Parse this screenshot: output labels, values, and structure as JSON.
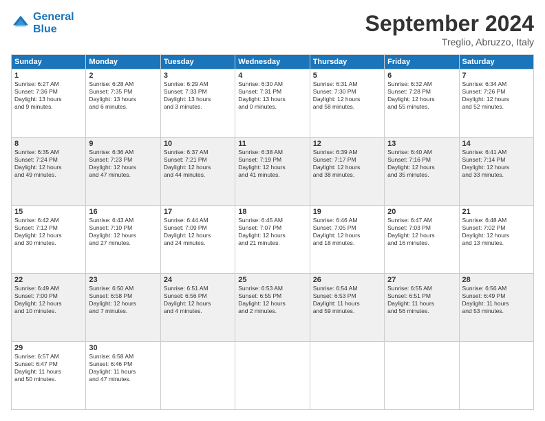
{
  "header": {
    "logo_line1": "General",
    "logo_line2": "Blue",
    "month": "September 2024",
    "location": "Treglio, Abruzzo, Italy"
  },
  "days_of_week": [
    "Sunday",
    "Monday",
    "Tuesday",
    "Wednesday",
    "Thursday",
    "Friday",
    "Saturday"
  ],
  "rows": [
    [
      {
        "day": "1",
        "lines": [
          "Sunrise: 6:27 AM",
          "Sunset: 7:36 PM",
          "Daylight: 13 hours",
          "and 9 minutes."
        ]
      },
      {
        "day": "2",
        "lines": [
          "Sunrise: 6:28 AM",
          "Sunset: 7:35 PM",
          "Daylight: 13 hours",
          "and 6 minutes."
        ]
      },
      {
        "day": "3",
        "lines": [
          "Sunrise: 6:29 AM",
          "Sunset: 7:33 PM",
          "Daylight: 13 hours",
          "and 3 minutes."
        ]
      },
      {
        "day": "4",
        "lines": [
          "Sunrise: 6:30 AM",
          "Sunset: 7:31 PM",
          "Daylight: 13 hours",
          "and 0 minutes."
        ]
      },
      {
        "day": "5",
        "lines": [
          "Sunrise: 6:31 AM",
          "Sunset: 7:30 PM",
          "Daylight: 12 hours",
          "and 58 minutes."
        ]
      },
      {
        "day": "6",
        "lines": [
          "Sunrise: 6:32 AM",
          "Sunset: 7:28 PM",
          "Daylight: 12 hours",
          "and 55 minutes."
        ]
      },
      {
        "day": "7",
        "lines": [
          "Sunrise: 6:34 AM",
          "Sunset: 7:26 PM",
          "Daylight: 12 hours",
          "and 52 minutes."
        ]
      }
    ],
    [
      {
        "day": "8",
        "lines": [
          "Sunrise: 6:35 AM",
          "Sunset: 7:24 PM",
          "Daylight: 12 hours",
          "and 49 minutes."
        ]
      },
      {
        "day": "9",
        "lines": [
          "Sunrise: 6:36 AM",
          "Sunset: 7:23 PM",
          "Daylight: 12 hours",
          "and 47 minutes."
        ]
      },
      {
        "day": "10",
        "lines": [
          "Sunrise: 6:37 AM",
          "Sunset: 7:21 PM",
          "Daylight: 12 hours",
          "and 44 minutes."
        ]
      },
      {
        "day": "11",
        "lines": [
          "Sunrise: 6:38 AM",
          "Sunset: 7:19 PM",
          "Daylight: 12 hours",
          "and 41 minutes."
        ]
      },
      {
        "day": "12",
        "lines": [
          "Sunrise: 6:39 AM",
          "Sunset: 7:17 PM",
          "Daylight: 12 hours",
          "and 38 minutes."
        ]
      },
      {
        "day": "13",
        "lines": [
          "Sunrise: 6:40 AM",
          "Sunset: 7:16 PM",
          "Daylight: 12 hours",
          "and 35 minutes."
        ]
      },
      {
        "day": "14",
        "lines": [
          "Sunrise: 6:41 AM",
          "Sunset: 7:14 PM",
          "Daylight: 12 hours",
          "and 33 minutes."
        ]
      }
    ],
    [
      {
        "day": "15",
        "lines": [
          "Sunrise: 6:42 AM",
          "Sunset: 7:12 PM",
          "Daylight: 12 hours",
          "and 30 minutes."
        ]
      },
      {
        "day": "16",
        "lines": [
          "Sunrise: 6:43 AM",
          "Sunset: 7:10 PM",
          "Daylight: 12 hours",
          "and 27 minutes."
        ]
      },
      {
        "day": "17",
        "lines": [
          "Sunrise: 6:44 AM",
          "Sunset: 7:09 PM",
          "Daylight: 12 hours",
          "and 24 minutes."
        ]
      },
      {
        "day": "18",
        "lines": [
          "Sunrise: 6:45 AM",
          "Sunset: 7:07 PM",
          "Daylight: 12 hours",
          "and 21 minutes."
        ]
      },
      {
        "day": "19",
        "lines": [
          "Sunrise: 6:46 AM",
          "Sunset: 7:05 PM",
          "Daylight: 12 hours",
          "and 18 minutes."
        ]
      },
      {
        "day": "20",
        "lines": [
          "Sunrise: 6:47 AM",
          "Sunset: 7:03 PM",
          "Daylight: 12 hours",
          "and 16 minutes."
        ]
      },
      {
        "day": "21",
        "lines": [
          "Sunrise: 6:48 AM",
          "Sunset: 7:02 PM",
          "Daylight: 12 hours",
          "and 13 minutes."
        ]
      }
    ],
    [
      {
        "day": "22",
        "lines": [
          "Sunrise: 6:49 AM",
          "Sunset: 7:00 PM",
          "Daylight: 12 hours",
          "and 10 minutes."
        ]
      },
      {
        "day": "23",
        "lines": [
          "Sunrise: 6:50 AM",
          "Sunset: 6:58 PM",
          "Daylight: 12 hours",
          "and 7 minutes."
        ]
      },
      {
        "day": "24",
        "lines": [
          "Sunrise: 6:51 AM",
          "Sunset: 6:56 PM",
          "Daylight: 12 hours",
          "and 4 minutes."
        ]
      },
      {
        "day": "25",
        "lines": [
          "Sunrise: 6:53 AM",
          "Sunset: 6:55 PM",
          "Daylight: 12 hours",
          "and 2 minutes."
        ]
      },
      {
        "day": "26",
        "lines": [
          "Sunrise: 6:54 AM",
          "Sunset: 6:53 PM",
          "Daylight: 11 hours",
          "and 59 minutes."
        ]
      },
      {
        "day": "27",
        "lines": [
          "Sunrise: 6:55 AM",
          "Sunset: 6:51 PM",
          "Daylight: 11 hours",
          "and 56 minutes."
        ]
      },
      {
        "day": "28",
        "lines": [
          "Sunrise: 6:56 AM",
          "Sunset: 6:49 PM",
          "Daylight: 11 hours",
          "and 53 minutes."
        ]
      }
    ],
    [
      {
        "day": "29",
        "lines": [
          "Sunrise: 6:57 AM",
          "Sunset: 6:47 PM",
          "Daylight: 11 hours",
          "and 50 minutes."
        ]
      },
      {
        "day": "30",
        "lines": [
          "Sunrise: 6:58 AM",
          "Sunset: 6:46 PM",
          "Daylight: 11 hours",
          "and 47 minutes."
        ]
      },
      {
        "day": "",
        "lines": []
      },
      {
        "day": "",
        "lines": []
      },
      {
        "day": "",
        "lines": []
      },
      {
        "day": "",
        "lines": []
      },
      {
        "day": "",
        "lines": []
      }
    ]
  ]
}
